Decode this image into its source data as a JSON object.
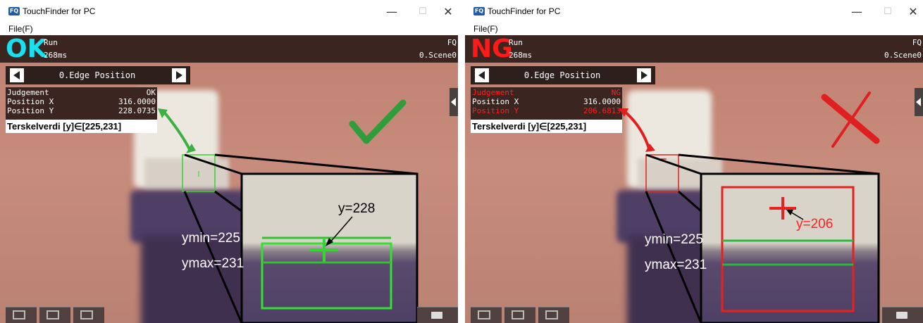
{
  "window": {
    "title": "TouchFinder for PC",
    "menu_file": "File(F)",
    "minimize": "—",
    "maximize": "☐",
    "close": "✕"
  },
  "ok_panel": {
    "judgement_big": "OK",
    "judgement_color": "#18e0f0",
    "run_label": "Run",
    "time": "268ms",
    "fq_label": "FQ",
    "scene_label": "0.Scene0",
    "nav_label": "0.Edge Position",
    "results": [
      {
        "key": "Judgement",
        "value": "OK",
        "color": "#ffffff"
      },
      {
        "key": "Position X",
        "value": "316.0000",
        "color": "#ffffff"
      },
      {
        "key": "Position Y",
        "value": "228.0735",
        "color": "#ffffff"
      }
    ],
    "threshold": "Terskelverdi [y]∈[225,231]",
    "ann_y": "y=228",
    "ann_ymin": "ymin=225",
    "ann_ymax": "ymax=231",
    "accent": "#33d433"
  },
  "ng_panel": {
    "judgement_big": "NG",
    "judgement_color": "#ff1a1a",
    "run_label": "Run",
    "time": "268ms",
    "fq_label": "FQ",
    "scene_label": "0.Scene0",
    "nav_label": "0.Edge Position",
    "results": [
      {
        "key": "Judgement",
        "value": "NG",
        "color": "#ff2020"
      },
      {
        "key": "Position X",
        "value": "316.0000",
        "color": "#ffffff"
      },
      {
        "key": "Position Y",
        "value": "206.6813",
        "color": "#ff2020"
      }
    ],
    "threshold": "Terskelverdi [y]∈[225,231]",
    "ann_y": "y=206",
    "ann_ymin": "ymin=225",
    "ann_ymax": "ymax=231",
    "accent": "#e82020"
  },
  "toolbar_icons": [
    "frame-icon",
    "zoom-icon",
    "camera-icon",
    "toolbox-icon"
  ]
}
